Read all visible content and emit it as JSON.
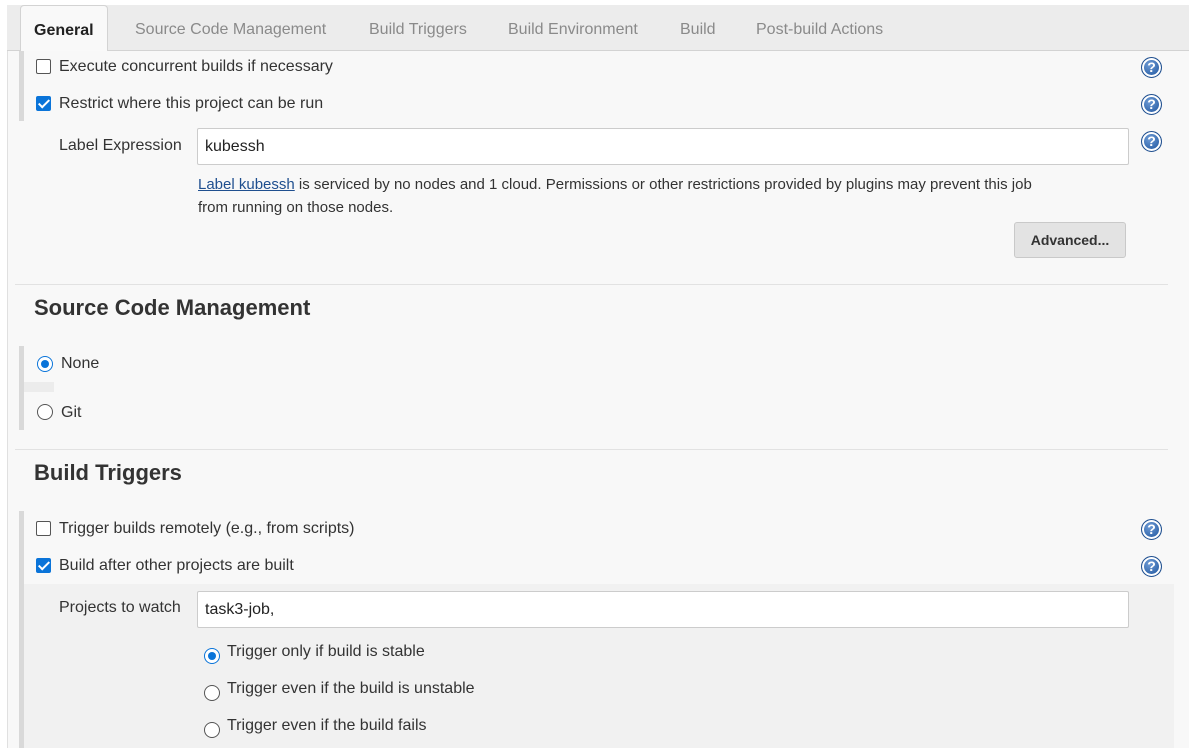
{
  "tabs": [
    {
      "label": "General",
      "active": true
    },
    {
      "label": "Source Code Management"
    },
    {
      "label": "Build Triggers"
    },
    {
      "label": "Build Environment"
    },
    {
      "label": "Build"
    },
    {
      "label": "Post-build Actions"
    }
  ],
  "general": {
    "concurrent_label": "Execute concurrent builds if necessary",
    "concurrent_checked": false,
    "restrict_label": "Restrict where this project can be run",
    "restrict_checked": true,
    "label_expression_label": "Label Expression",
    "label_expression_value": "kubessh",
    "info_link": "Label kubessh",
    "info_line1": " is serviced by no nodes and 1 cloud. Permissions or other restrictions provided by plugins may prevent this job",
    "info_line2": "from running on those nodes.",
    "advanced_button": "Advanced..."
  },
  "scm": {
    "title": "Source Code Management",
    "options": [
      {
        "label": "None",
        "selected": true
      },
      {
        "label": "Git",
        "selected": false
      }
    ]
  },
  "triggers": {
    "title": "Build Triggers",
    "remote_label": "Trigger builds remotely (e.g., from scripts)",
    "remote_checked": false,
    "after_label": "Build after other projects are built",
    "after_checked": true,
    "projects_label": "Projects to watch",
    "projects_value": "task3-job,",
    "options": [
      {
        "label": "Trigger only if build is stable",
        "selected": true
      },
      {
        "label": "Trigger even if the build is unstable",
        "selected": false
      },
      {
        "label": "Trigger even if the build fails",
        "selected": false
      }
    ]
  },
  "icons": {
    "help": "help-icon"
  },
  "colors": {
    "accent": "#0a74d9",
    "link": "#1f4f8f",
    "help": "#2d62a8"
  }
}
